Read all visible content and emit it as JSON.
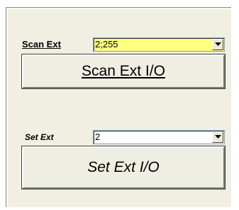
{
  "scan_ext": {
    "label": "Scan Ext",
    "combo_value": "2;255",
    "combo_bg": "#ffff80",
    "button_label": "Scan Ext I/O"
  },
  "set_ext": {
    "label": "Set Ext",
    "combo_value": "2",
    "combo_bg": "#ffffff",
    "button_label": "Set Ext I/O"
  },
  "icons": {
    "dropdown": "chevron-down-icon"
  }
}
